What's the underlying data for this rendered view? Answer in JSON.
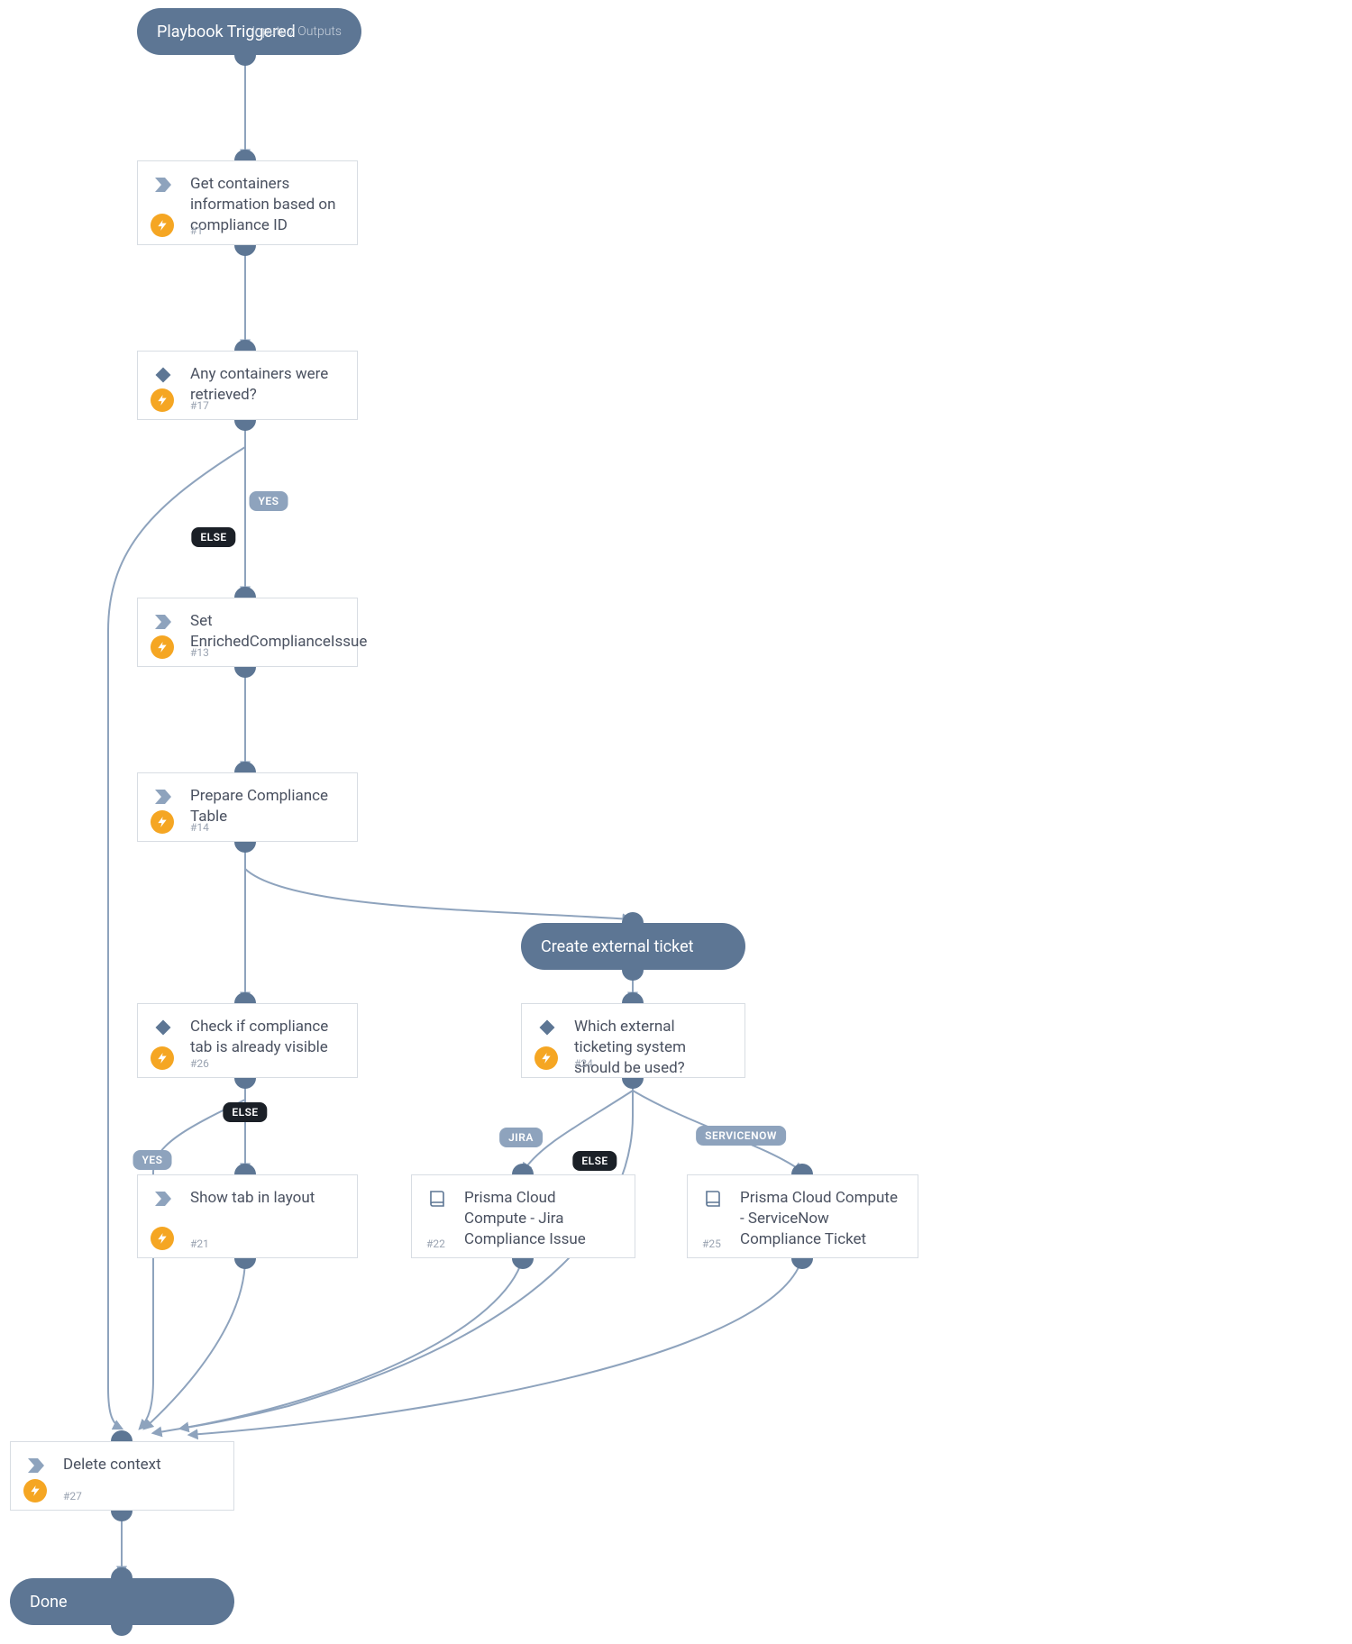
{
  "start": {
    "label": "Playbook Triggered",
    "sub": "Inputs / Outputs"
  },
  "section": {
    "label": "Create external ticket"
  },
  "done": {
    "label": "Done"
  },
  "tasks": {
    "t1": {
      "title": "Get containers information based on compliance ID",
      "id": "#1"
    },
    "t17": {
      "title": "Any containers were retrieved?",
      "id": "#17"
    },
    "t13": {
      "title": "Set EnrichedComplianceIssue",
      "id": "#13"
    },
    "t14": {
      "title": "Prepare Compliance Table",
      "id": "#14"
    },
    "t26": {
      "title": "Check if compliance tab is already visible",
      "id": "#26"
    },
    "t21": {
      "title": "Show tab in layout",
      "id": "#21"
    },
    "t24": {
      "title": "Which external ticketing system should be used?",
      "id": "#24"
    },
    "t22": {
      "title": "Prisma Cloud Compute - Jira Compliance Issue",
      "id": "#22"
    },
    "t25": {
      "title": "Prisma Cloud Compute - ServiceNow Compliance Ticket",
      "id": "#25"
    },
    "t27": {
      "title": "Delete context",
      "id": "#27"
    }
  },
  "labels": {
    "yes": "YES",
    "else": "ELSE",
    "jira": "JIRA",
    "servicenow": "SERVICENOW"
  },
  "icons": {
    "action": "chevron-icon",
    "condition": "diamond-icon",
    "playbook": "book-icon",
    "auto": "bolt-icon"
  }
}
